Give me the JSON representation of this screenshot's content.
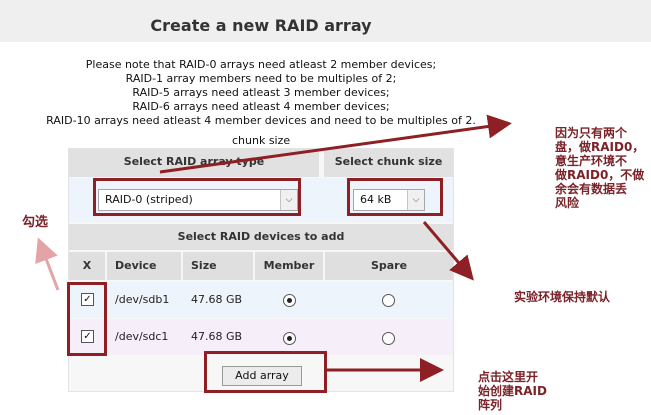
{
  "page": {
    "title": "Create a new RAID array",
    "notes": [
      "Please note that RAID-0 arrays need atleast 2 member devices;",
      "RAID-1 array members need to be multiples of 2;",
      "RAID-5 arrays need atleast 3 member devices;",
      "RAID-6 arrays need atleast 4 member devices;",
      "RAID-10 arrays need atleast 4 member devices and need to be multiples of 2."
    ],
    "chunk_note": "chunk size"
  },
  "raid_type": {
    "header": "Select RAID array type",
    "selected": "RAID-0 (striped)"
  },
  "chunk": {
    "header": "Select chunk size",
    "selected": "64 kB"
  },
  "devices": {
    "header": "Select RAID devices to add",
    "columns": [
      "X",
      "Device",
      "Size",
      "Member",
      "Spare"
    ],
    "rows": [
      {
        "checked": true,
        "device": "/dev/sdb1",
        "size": "47.68 GB",
        "member": true,
        "spare": false
      },
      {
        "checked": true,
        "device": "/dev/sdc1",
        "size": "47.68 GB",
        "member": true,
        "spare": false
      }
    ]
  },
  "add_button": "Add array",
  "annotations": {
    "check_label": "勾选",
    "right_note": [
      "因为只有两个",
      "盘，做RAID0，",
      "意生产环境不",
      "做RAID0，不做",
      "余会有数据丢",
      "风险"
    ],
    "default_note": "实验环境保持默认",
    "click_note": [
      "点击这里开",
      "始创建RAID",
      "阵列"
    ],
    "accent_color": "#8e1f24",
    "checkmark_glyph": "✓",
    "chevron_glyph": "⌵"
  }
}
